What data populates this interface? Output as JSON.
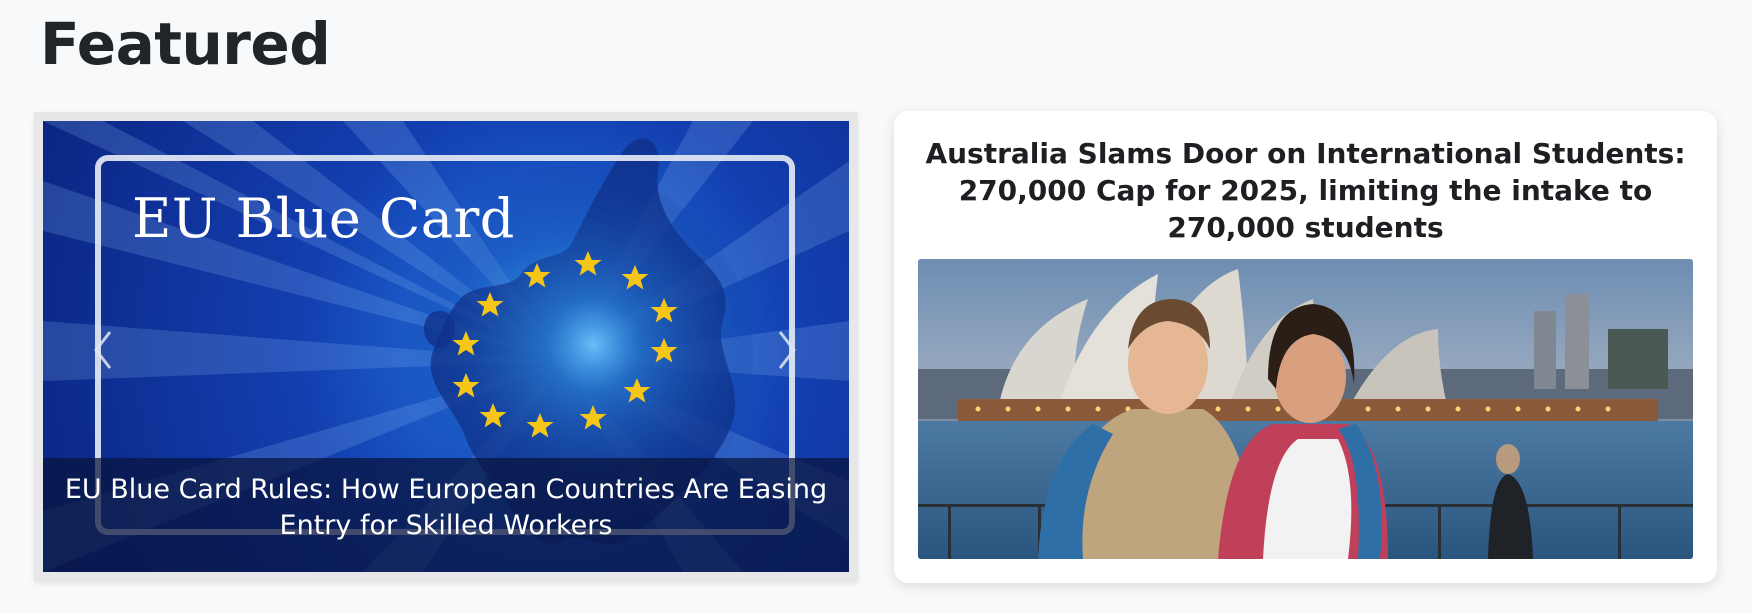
{
  "section": {
    "title": "Featured"
  },
  "carousel": {
    "slide_image_text": "EU Blue Card",
    "caption": "EU Blue Card Rules: How European Countries Are Easing Entry for Skilled Workers",
    "prev_icon": "chevron-left-icon",
    "next_icon": "chevron-right-icon"
  },
  "article": {
    "headline": "Australia Slams Door on International Students: 270,000 Cap for 2025, limiting the intake to 270,000 students"
  },
  "colors": {
    "eu_blue": "#133fb0",
    "star_yellow": "#f5c518",
    "caption_overlay": "#08143c"
  }
}
